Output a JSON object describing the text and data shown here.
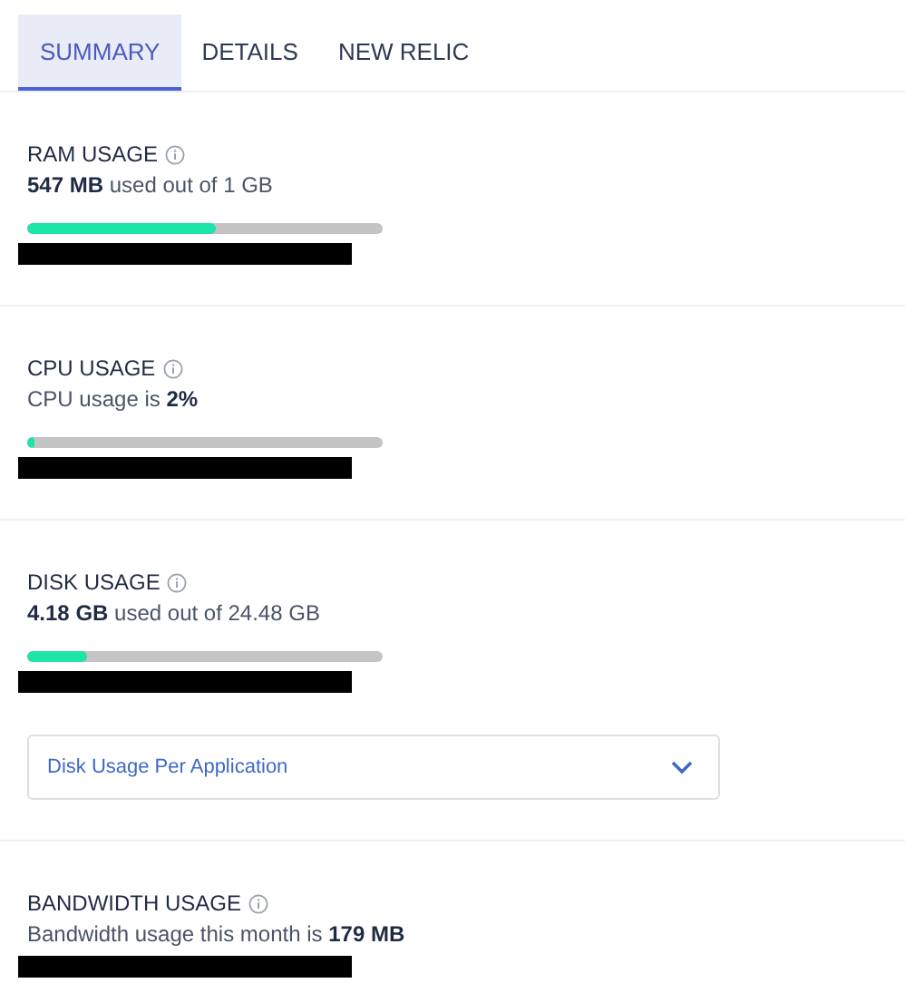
{
  "tabs": [
    {
      "label": "SUMMARY",
      "selected": true
    },
    {
      "label": "DETAILS",
      "selected": false
    },
    {
      "label": "NEW RELIC",
      "selected": false
    }
  ],
  "sections": [
    {
      "title": "RAM USAGE",
      "text": "**547 MB** used out of 1 GB",
      "level": 0.53,
      "redacted": true
    },
    {
      "title": "CPU USAGE",
      "text": "CPU usage is **2%**",
      "level": 0.02,
      "redacted": true
    },
    {
      "title": "DISK USAGE",
      "text": "**4.18 GB** used out of 24.48 GB",
      "level": 0.17,
      "redacted": true,
      "dropdown": "Disk Usage Per Application"
    },
    {
      "title": "BANDWIDTH USAGE",
      "text": "Bandwidth usage this month is **179 MB**",
      "redacted": true
    }
  ]
}
